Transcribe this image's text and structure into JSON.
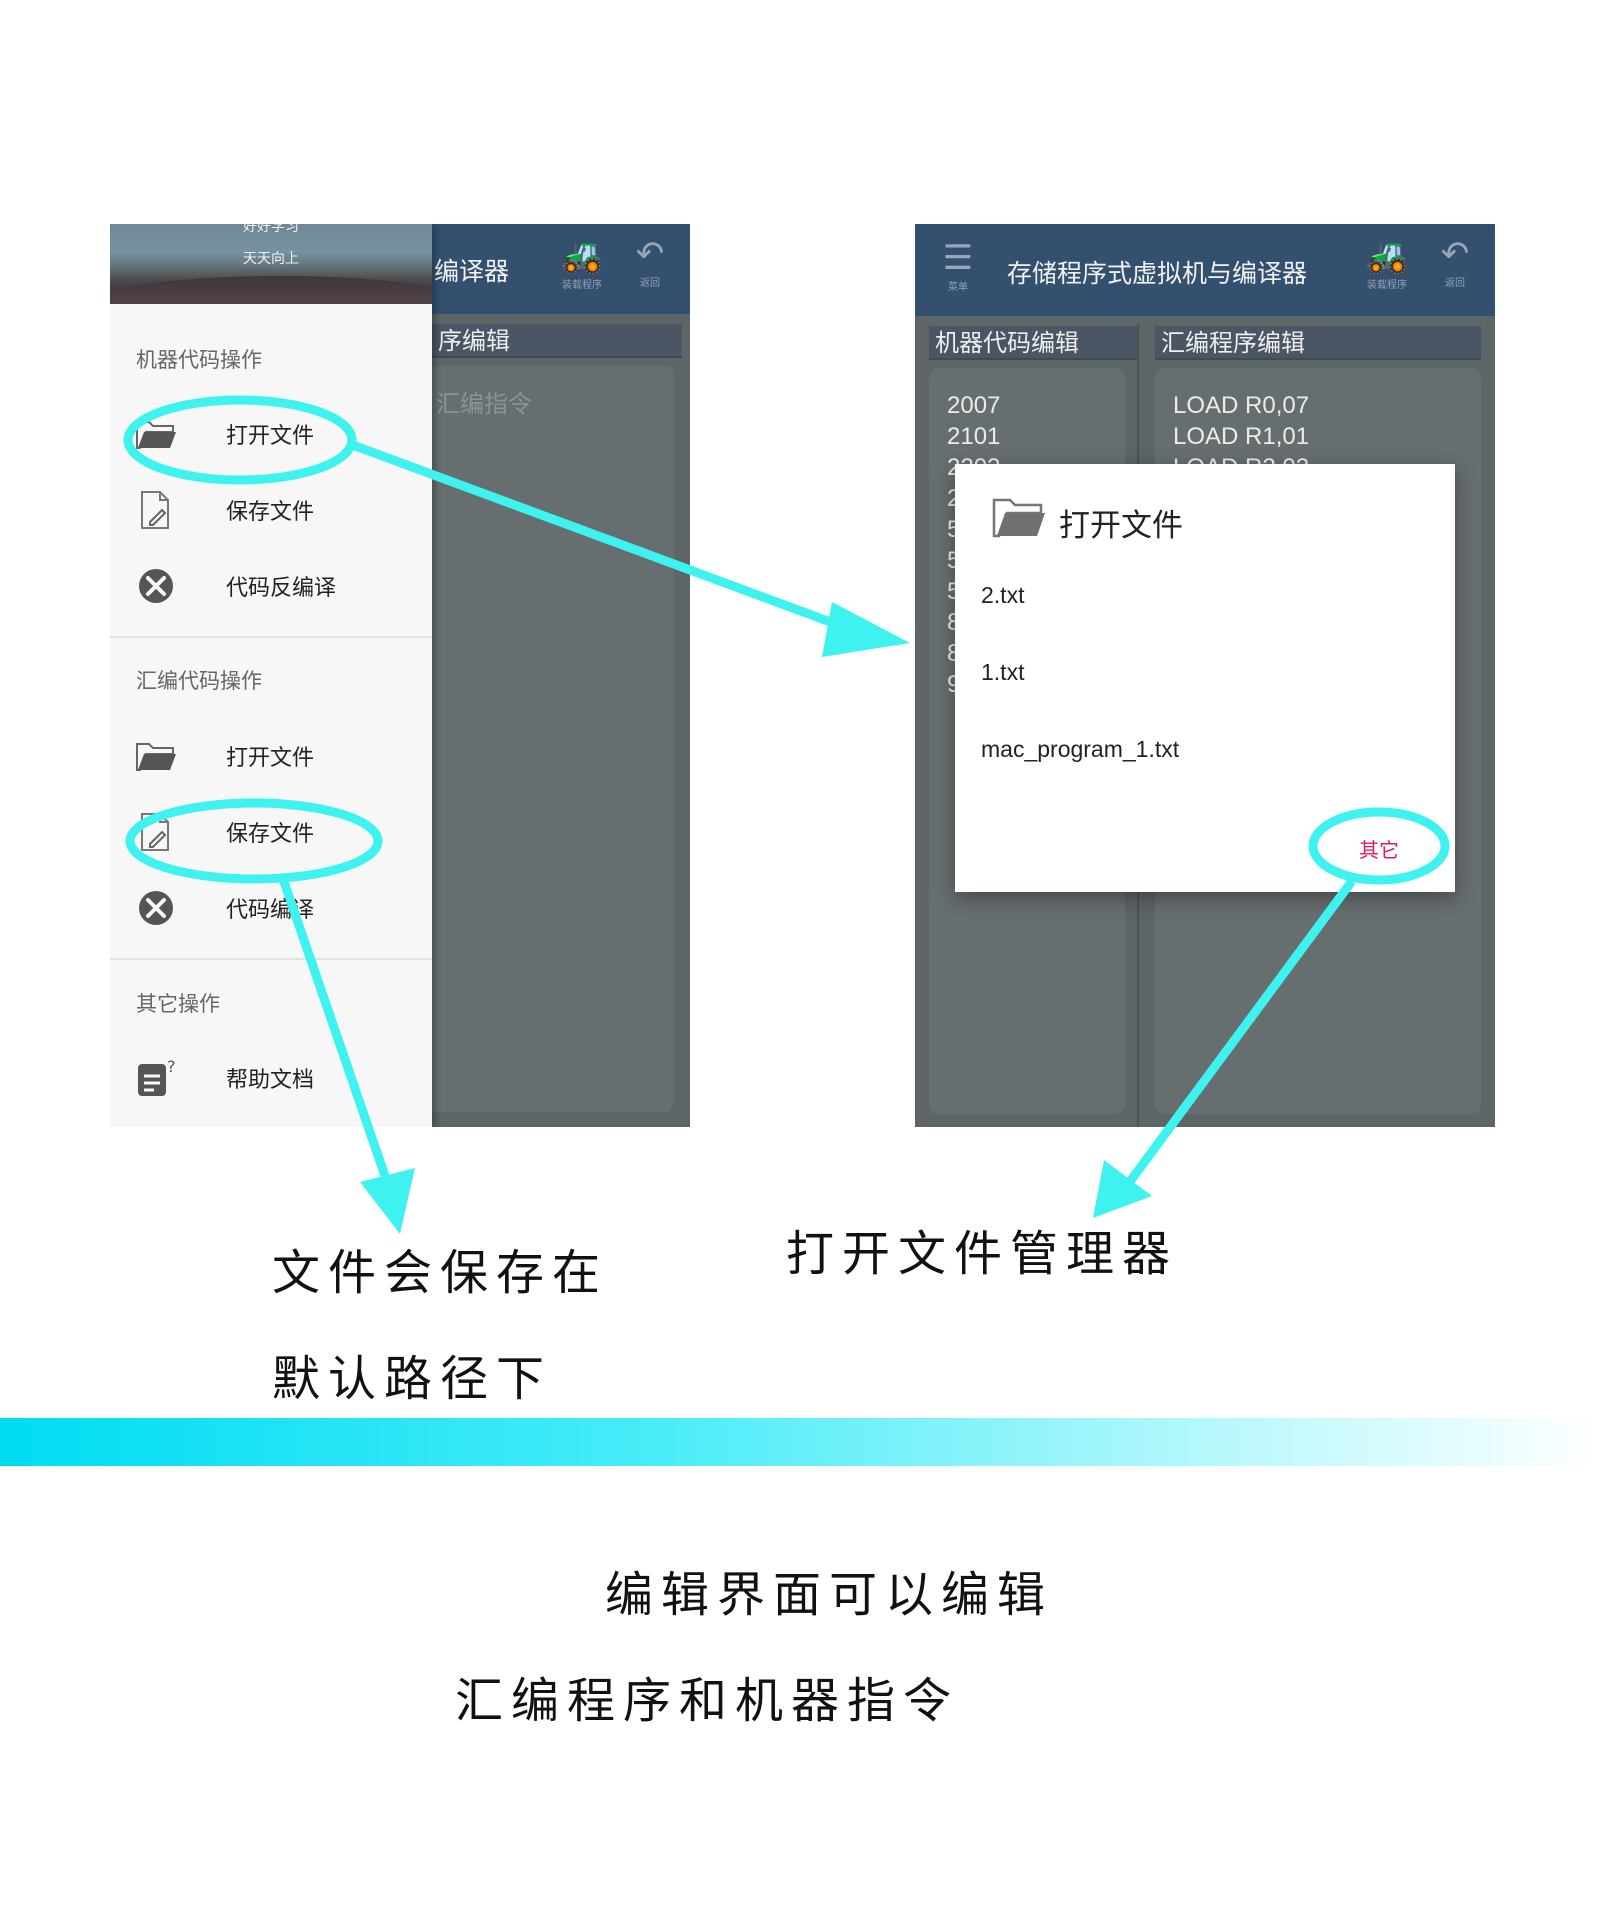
{
  "left_screen": {
    "appbar_title_partial": "编译器",
    "appbar_icons": [
      {
        "icon": "install-program-icon",
        "label": "装载程序"
      },
      {
        "icon": "back-arrow-icon",
        "label": "返回"
      }
    ],
    "section_header_partial": "序编辑",
    "editor_placeholder_partial": "汇编指令",
    "drawer": {
      "header_text_line1": "好好学习",
      "header_text_line2": "天天向上",
      "sections": [
        {
          "title": "机器代码操作",
          "items": [
            {
              "icon": "folder-open-icon",
              "label": "打开文件"
            },
            {
              "icon": "file-edit-icon",
              "label": "保存文件"
            },
            {
              "icon": "tools-icon",
              "label": "代码反编译"
            }
          ]
        },
        {
          "title": "汇编代码操作",
          "items": [
            {
              "icon": "folder-open-icon",
              "label": "打开文件"
            },
            {
              "icon": "file-edit-icon",
              "label": "保存文件"
            },
            {
              "icon": "tools-icon",
              "label": "代码编译"
            }
          ]
        },
        {
          "title": "其它操作",
          "items": [
            {
              "icon": "help-doc-icon",
              "label": "帮助文档"
            }
          ]
        }
      ]
    }
  },
  "right_screen": {
    "menu_label": "菜单",
    "appbar_title": "存储程序式虚拟机与编译器",
    "appbar_icons": [
      {
        "icon": "install-program-icon",
        "label": "装载程序"
      },
      {
        "icon": "back-arrow-icon",
        "label": "返回"
      }
    ],
    "machine_header": "机器代码编辑",
    "assembly_header": "汇编程序编辑",
    "machine_code_lines": [
      "2007",
      "2101"
    ],
    "machine_code_partial": [
      "2202",
      "2",
      "5",
      "5",
      "5",
      "8",
      "8",
      "9"
    ],
    "assembly_lines": [
      "LOAD R0,07",
      "LOAD R1,01"
    ],
    "assembly_partial": "LOAD R2,02",
    "dialog": {
      "title": "打开文件",
      "files": [
        "2.txt",
        "1.txt",
        "mac_program_1.txt"
      ],
      "other_button": "其它"
    }
  },
  "annotations": {
    "save_note_line1": "文件会保存在",
    "save_note_line2": "默认路径下",
    "open_note": "打开文件管理器",
    "bottom_note_line1": "编辑界面可以编辑",
    "bottom_note_line2": "汇编程序和机器指令"
  },
  "colors": {
    "appbar": "#34506f",
    "editor_bg": "#5e6566",
    "annotation_cyan": "#3ef2f0",
    "accent_pink": "#e01c5f"
  }
}
